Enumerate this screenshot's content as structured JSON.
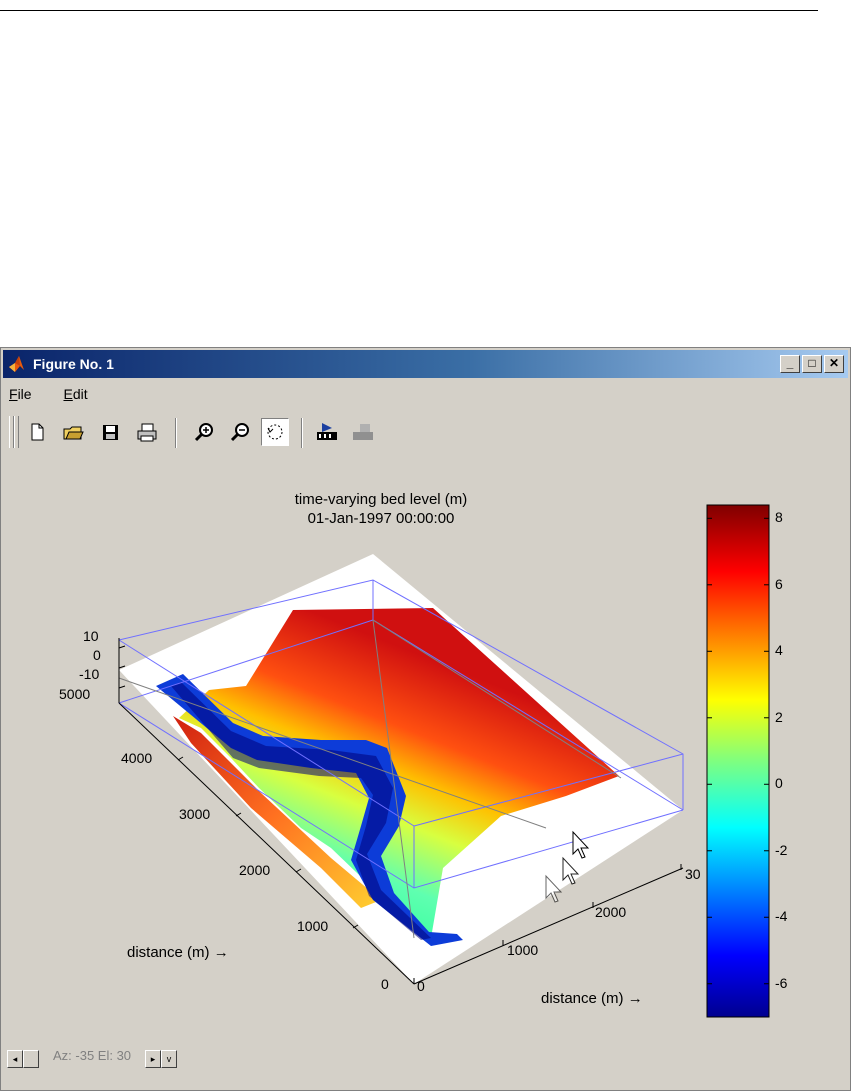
{
  "window": {
    "title": "Figure No. 1",
    "minimize": "_",
    "maximize": "□",
    "close": "✕"
  },
  "menu": [
    {
      "label": "File",
      "accel": "F"
    },
    {
      "label": "Edit",
      "accel": "E"
    }
  ],
  "toolbar": {
    "buttons": [
      "new-figure",
      "open-file",
      "save",
      "print",
      "zoom-in",
      "zoom-out",
      "rotate-3d",
      "camera-toolbar",
      "plot-edit"
    ]
  },
  "plot": {
    "title_line1": "time-varying bed level (m)",
    "title_line2": "01-Jan-1997 00:00:00",
    "xlabel": "distance (m) →",
    "ylabel": "distance (m) →",
    "z_ticks": [
      "10",
      "0",
      "-10"
    ],
    "y_ticks": [
      "5000",
      "4000",
      "3000",
      "2000",
      "1000",
      "0"
    ],
    "x_ticks": [
      "0",
      "1000",
      "2000",
      "30"
    ],
    "colorbar": {
      "ticks": [
        "8",
        "6",
        "4",
        "2",
        "0",
        "-2",
        "-4",
        "-6"
      ],
      "min": -7,
      "max": 8.4
    }
  },
  "status": {
    "azel": "Az: -35 El: 30"
  }
}
